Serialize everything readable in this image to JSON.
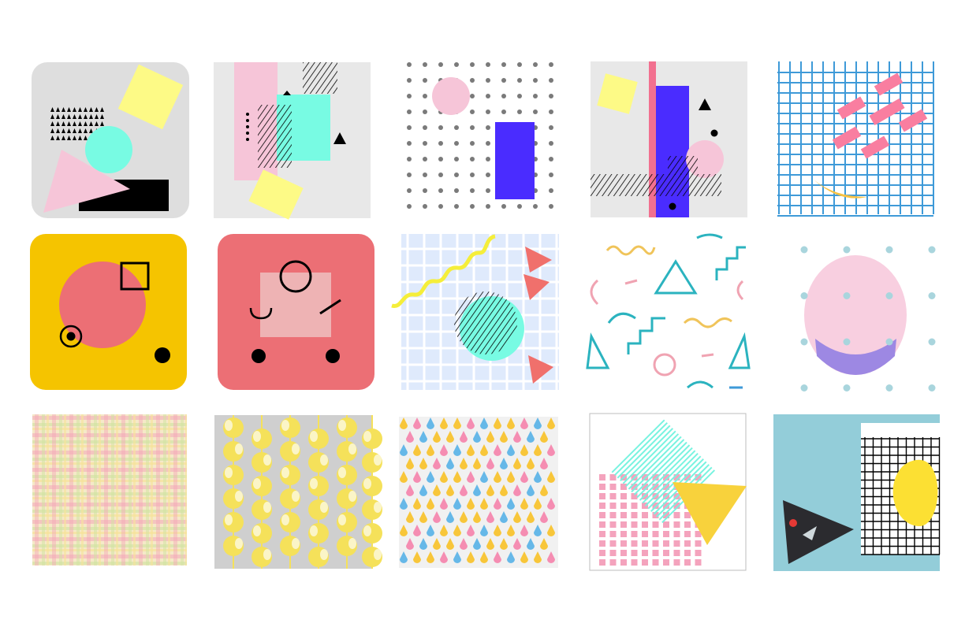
{
  "palette": {
    "background": "#ffffff",
    "light_gray": "#e6e6e6",
    "pink": "#f6c5d8",
    "mint": "#78fbe3",
    "yellow": "#fdfa86",
    "blue": "#4a2cff",
    "coral": "#ec6f75",
    "gold": "#f5c400",
    "grid_blue": "#3e9ad8",
    "teal": "#2bb3bf",
    "lilac": "#9d88e3",
    "sky": "#93cdd9"
  },
  "tiles": [
    {
      "name": "tile-memphis-triangle",
      "motif": "memphis-shapes"
    },
    {
      "name": "tile-memphis-stripes",
      "motif": "memphis-blocks"
    },
    {
      "name": "tile-dot-grid",
      "motif": "dot-grid"
    },
    {
      "name": "tile-blue-bar",
      "motif": "memphis-bars"
    },
    {
      "name": "tile-blue-grid",
      "motif": "grid-confetti"
    },
    {
      "name": "tile-yellow-face",
      "motif": "geometric-face"
    },
    {
      "name": "tile-coral-face",
      "motif": "geometric-face"
    },
    {
      "name": "tile-squiggle-grid",
      "motif": "grid-squiggle"
    },
    {
      "name": "tile-confetti",
      "motif": "confetti"
    },
    {
      "name": "tile-pink-oval",
      "motif": "oval-dots"
    },
    {
      "name": "tile-plaid",
      "motif": "plaid"
    },
    {
      "name": "tile-yellow-circles",
      "motif": "circles"
    },
    {
      "name": "tile-drops",
      "motif": "drops"
    },
    {
      "name": "tile-outlined-shapes",
      "motif": "outlined-shapes"
    },
    {
      "name": "tile-black-triangle",
      "motif": "grid-triangle"
    }
  ]
}
